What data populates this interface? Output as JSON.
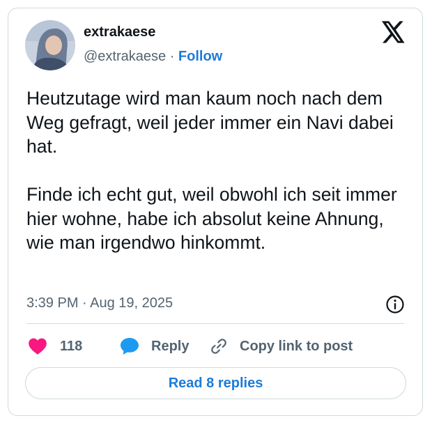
{
  "user": {
    "display_name": "extrakaese",
    "handle": "@extrakaese",
    "separator": " · ",
    "follow_label": "Follow"
  },
  "tweet": {
    "paragraphs": [
      "Heutzutage wird man kaum noch nach dem Weg gefragt, weil jeder immer ein Navi dabei hat.",
      "Finde ich echt gut, weil obwohl ich seit immer hier wohne, habe ich absolut keine Ahnung, wie man irgendwo hinkommt."
    ],
    "timestamp": "3:39 PM · Aug 19, 2025"
  },
  "actions": {
    "like_count": "118",
    "reply_label": "Reply",
    "copy_link_label": "Copy link to post"
  },
  "read_replies_label": "Read 8 replies",
  "icons": {
    "logo": "x-logo-icon",
    "info": "info-icon",
    "like": "heart-icon",
    "reply": "speech-bubble-icon",
    "copy": "link-icon"
  },
  "colors": {
    "accent": "#1d7bd8",
    "like": "#f91880",
    "secondary_text": "#536471",
    "border": "#cfd9de"
  }
}
